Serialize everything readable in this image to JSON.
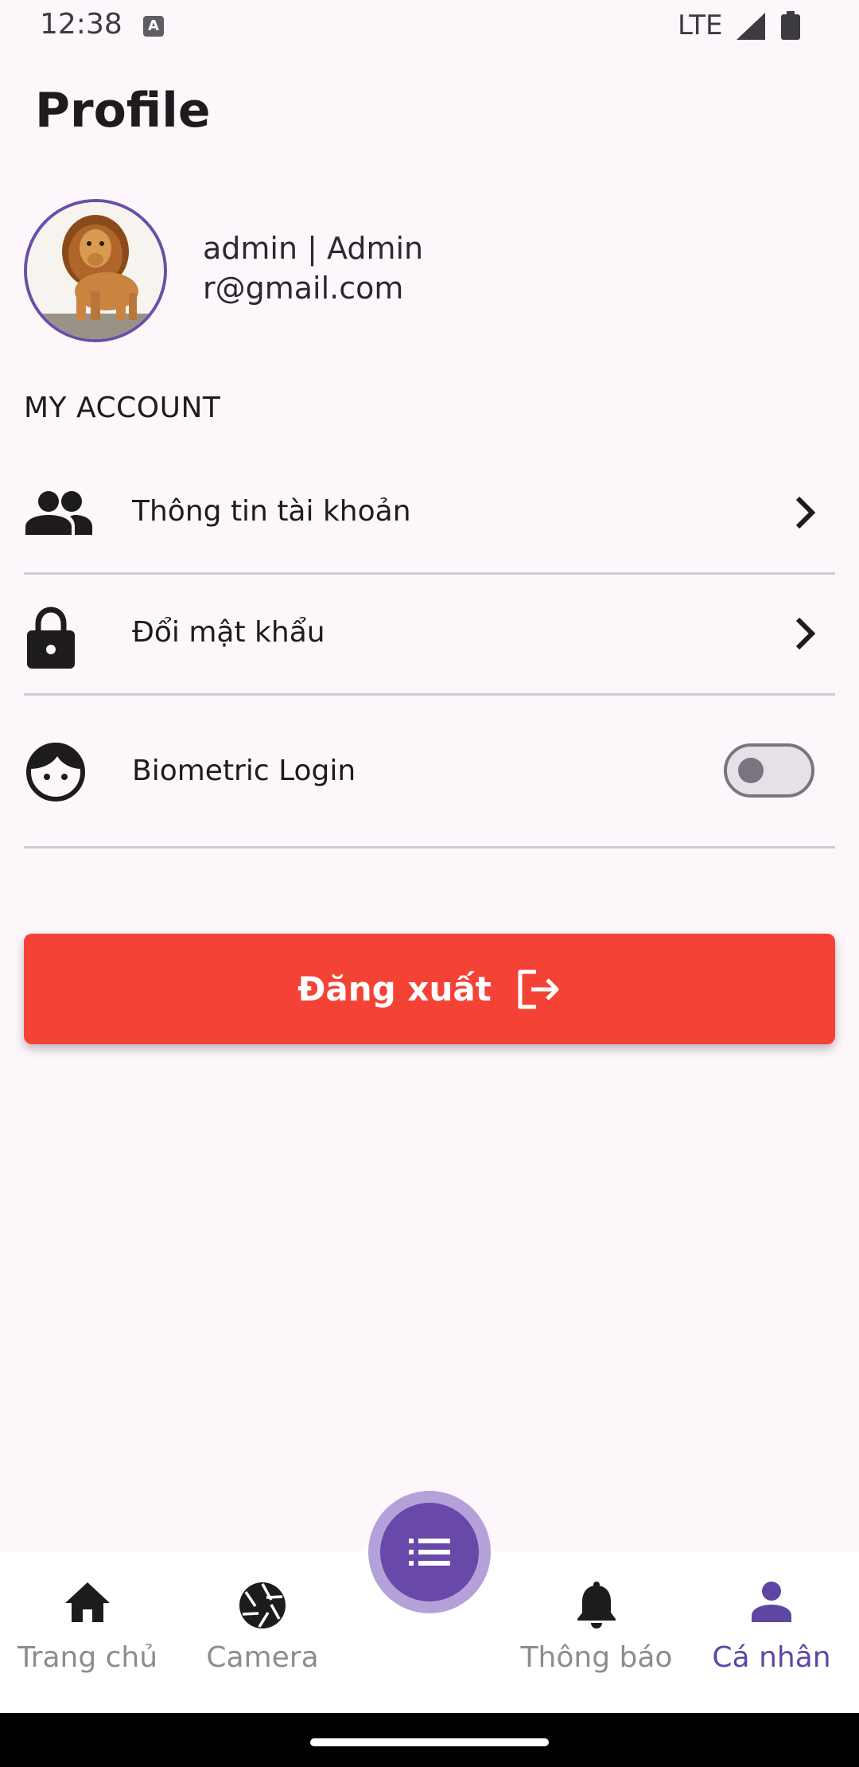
{
  "status_bar": {
    "time": "12:38",
    "network": "LTE",
    "icons": [
      "a-notification-icon",
      "signal-icon",
      "battery-icon"
    ]
  },
  "header": {
    "title": "Profile"
  },
  "user": {
    "line1": "admin | Admin",
    "line2": "r@gmail.com",
    "avatar": "lion-avatar"
  },
  "section": {
    "heading": "MY ACCOUNT"
  },
  "menu": {
    "account_info": {
      "label": "Thông tin tài khoản",
      "icon": "people-icon"
    },
    "change_password": {
      "label": "Đổi mật khẩu",
      "icon": "lock-icon"
    },
    "biometric": {
      "label": "Biometric Login",
      "icon": "face-icon",
      "enabled": false
    }
  },
  "logout": {
    "label": "Đăng xuất",
    "icon": "logout-icon",
    "color": "#f44336"
  },
  "bottom_nav": {
    "items": [
      {
        "label": "Trang chủ",
        "icon": "home-icon",
        "active": false
      },
      {
        "label": "Camera",
        "icon": "camera-aperture-icon",
        "active": false
      },
      {
        "label": "Thông báo",
        "icon": "bell-icon",
        "active": false
      },
      {
        "label": "Cá nhân",
        "icon": "person-icon",
        "active": true
      }
    ],
    "fab_icon": "list-icon",
    "accent": "#5e47a3"
  }
}
